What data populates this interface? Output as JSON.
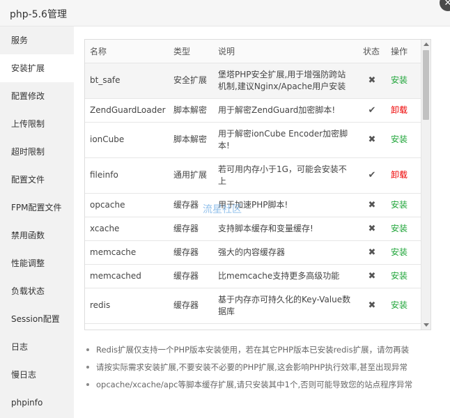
{
  "window": {
    "title": "php-5.6管理",
    "close_icon": "close-icon"
  },
  "sidebar": {
    "items": [
      {
        "label": "服务"
      },
      {
        "label": "安装扩展",
        "active": true
      },
      {
        "label": "配置修改"
      },
      {
        "label": "上传限制"
      },
      {
        "label": "超时限制"
      },
      {
        "label": "配置文件"
      },
      {
        "label": "FPM配置文件"
      },
      {
        "label": "禁用函数"
      },
      {
        "label": "性能调整"
      },
      {
        "label": "负载状态"
      },
      {
        "label": "Session配置"
      },
      {
        "label": "日志"
      },
      {
        "label": "慢日志"
      },
      {
        "label": "phpinfo"
      }
    ]
  },
  "table": {
    "headers": {
      "name": "名称",
      "type": "类型",
      "desc": "说明",
      "status": "状态",
      "op": "操作"
    },
    "rows": [
      {
        "name": "bt_safe",
        "type": "安全扩展",
        "desc": "堡塔PHP安全扩展,用于增强防跨站机制,建议Nginx/Apache用户安装",
        "status": "✖",
        "op": "安装",
        "installed": false
      },
      {
        "name": "ZendGuardLoader",
        "type": "脚本解密",
        "desc": "用于解密ZendGuard加密脚本!",
        "status": "✔",
        "op": "卸载",
        "installed": true
      },
      {
        "name": "ionCube",
        "type": "脚本解密",
        "desc": "用于解密ionCube Encoder加密脚本!",
        "status": "✖",
        "op": "安装",
        "installed": false
      },
      {
        "name": "fileinfo",
        "type": "通用扩展",
        "desc": "若可用内存小于1G，可能会安装不上",
        "status": "✔",
        "op": "卸载",
        "installed": true
      },
      {
        "name": "opcache",
        "type": "缓存器",
        "desc": "用于加速PHP脚本!",
        "status": "✖",
        "op": "安装",
        "installed": false
      },
      {
        "name": "xcache",
        "type": "缓存器",
        "desc": "支持脚本缓存和变量缓存!",
        "status": "✖",
        "op": "安装",
        "installed": false
      },
      {
        "name": "memcache",
        "type": "缓存器",
        "desc": "强大的内容缓存器",
        "status": "✖",
        "op": "安装",
        "installed": false
      },
      {
        "name": "memcached",
        "type": "缓存器",
        "desc": "比memcache支持更多高级功能",
        "status": "✖",
        "op": "安装",
        "installed": false
      },
      {
        "name": "redis",
        "type": "缓存器",
        "desc": "基于内存亦可持久化的Key-Value数据库",
        "status": "✖",
        "op": "安装",
        "installed": false
      }
    ]
  },
  "watermark": "流星社区",
  "notes": [
    "Redis扩展仅支持一个PHP版本安装使用，若在其它PHP版本已安装redis扩展，请勿再装",
    "请按实际需求安装扩展,不要安装不必要的PHP扩展,这会影响PHP执行效率,甚至出现异常",
    "opcache/xcache/apc等脚本缓存扩展,请只安装其中1个,否则可能导致您的站点程序异常"
  ],
  "colors": {
    "install": "#20a53a",
    "uninstall": "#ee0000",
    "sidebar_bg": "#f2f2f2"
  }
}
